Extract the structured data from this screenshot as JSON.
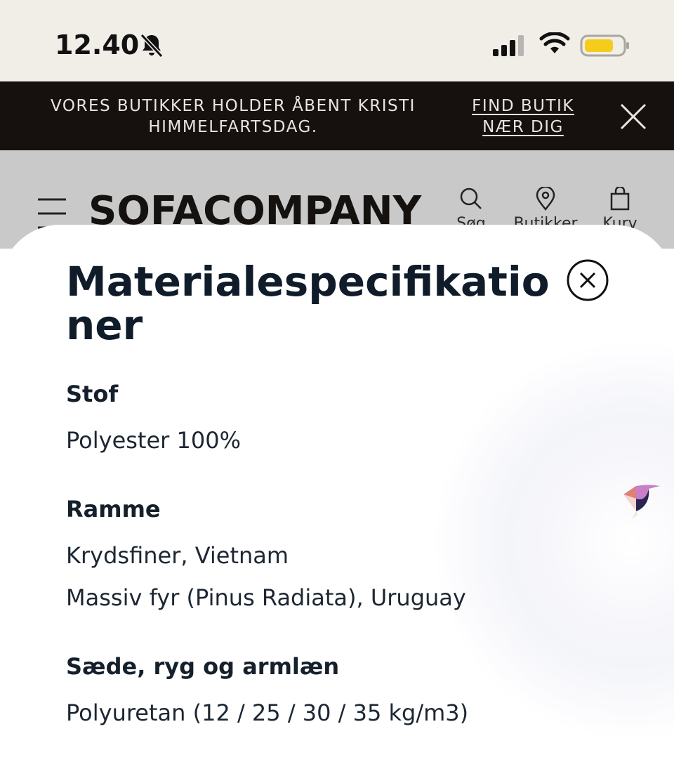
{
  "status_bar": {
    "time": "12.40",
    "icons": [
      "bell-muted-icon",
      "cellular-signal-icon",
      "wifi-icon",
      "battery-icon"
    ],
    "battery_color": "#f5cc1c"
  },
  "banner": {
    "message": "VORES BUTIKKER HOLDER ÅBENT KRISTI HIMMELFARTSDAG.",
    "link_label": "FIND BUTIK NÆR DIG"
  },
  "header": {
    "logo": "SOFACOMPANY",
    "nav": [
      {
        "label": "Søg",
        "icon": "search-icon"
      },
      {
        "label": "Butikker",
        "icon": "location-pin-icon"
      },
      {
        "label": "Kurv",
        "icon": "shopping-bag-icon"
      }
    ]
  },
  "sheet": {
    "title": "Materialespecifikationer",
    "sections": [
      {
        "heading": "Stof",
        "values": [
          "Polyester 100%"
        ]
      },
      {
        "heading": "Ramme",
        "values": [
          "Krydsfiner, Vietnam",
          "Massiv fyr (Pinus Radiata), Uruguay"
        ]
      },
      {
        "heading": "Sæde, ryg og armlæn",
        "values": [
          "Polyuretan (12 / 25 / 30 / 35 kg/m3)"
        ]
      }
    ],
    "chat_icon": "bird-chat-icon"
  },
  "colors": {
    "banner_bg": "#16110f",
    "status_bg": "#f1ede7",
    "header_dimmed_bg": "#c9c9c9",
    "title_color": "#101c2a"
  }
}
